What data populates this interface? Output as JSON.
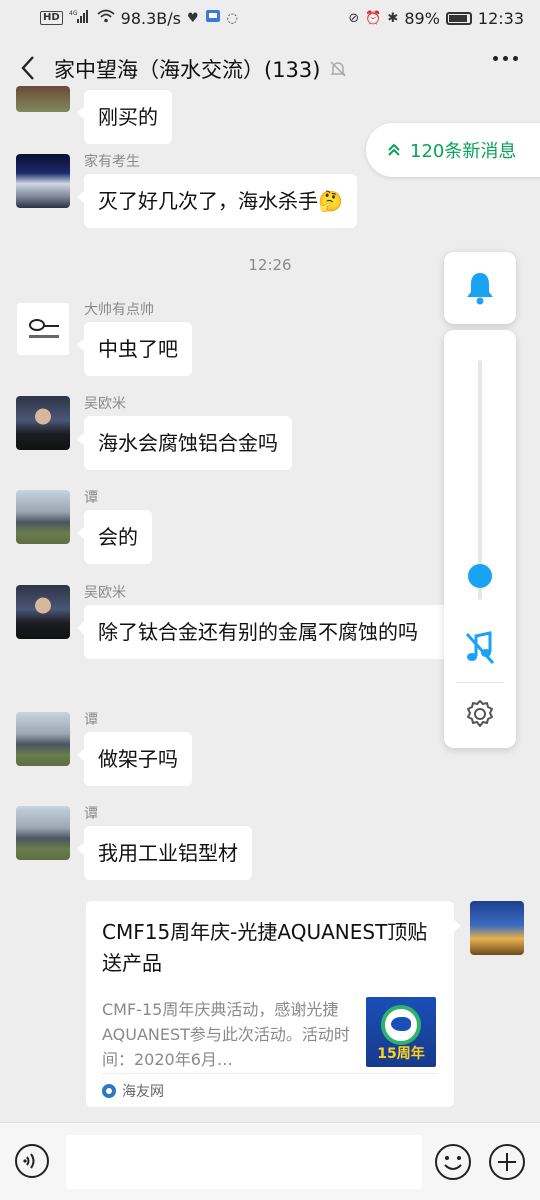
{
  "status_bar": {
    "network_speed": "98.3B/s",
    "battery": "89%",
    "time": "12:33"
  },
  "header": {
    "title": "家中望海（海水交流）(133)"
  },
  "new_messages": {
    "label": "120条新消息"
  },
  "timestamp": "12:26",
  "messages": [
    {
      "sender": "",
      "text": "刚买的"
    },
    {
      "sender": "家有考生",
      "text": "灭了好几次了，海水杀手🤔"
    },
    {
      "sender": "大帅有点帅",
      "text": "中虫了吧"
    },
    {
      "sender": "吴欧米",
      "text": "海水会腐蚀铝合金吗"
    },
    {
      "sender": "谭",
      "text": "会的"
    },
    {
      "sender": "吴欧米",
      "text": "除了钛合金还有别的金属不腐蚀的吗"
    },
    {
      "sender": "谭",
      "text": "做架子吗"
    },
    {
      "sender": "谭",
      "text": "我用工业铝型材"
    }
  ],
  "link_card": {
    "title": "CMF15周年庆-光捷AQUANEST顶贴送产品",
    "description": "CMF-15周年庆典活动，感谢光捷AQUANEST参与此次活动。活动时间：2020年6月…",
    "thumbnail_text": "15周年",
    "source": "海友网"
  },
  "floating_panel": {
    "volume_level": 0.1
  },
  "colors": {
    "accent_green": "#07a35a",
    "panel_blue": "#1aa3f5",
    "background": "#ededed"
  },
  "icons": {
    "back": "chevron-left-icon",
    "mute": "bell-off-icon",
    "more": "more-dots-icon",
    "bell": "bell-icon",
    "music_off": "music-off-icon",
    "settings": "gear-icon",
    "voice": "voice-icon",
    "emoji": "emoji-icon",
    "plus": "plus-icon"
  }
}
